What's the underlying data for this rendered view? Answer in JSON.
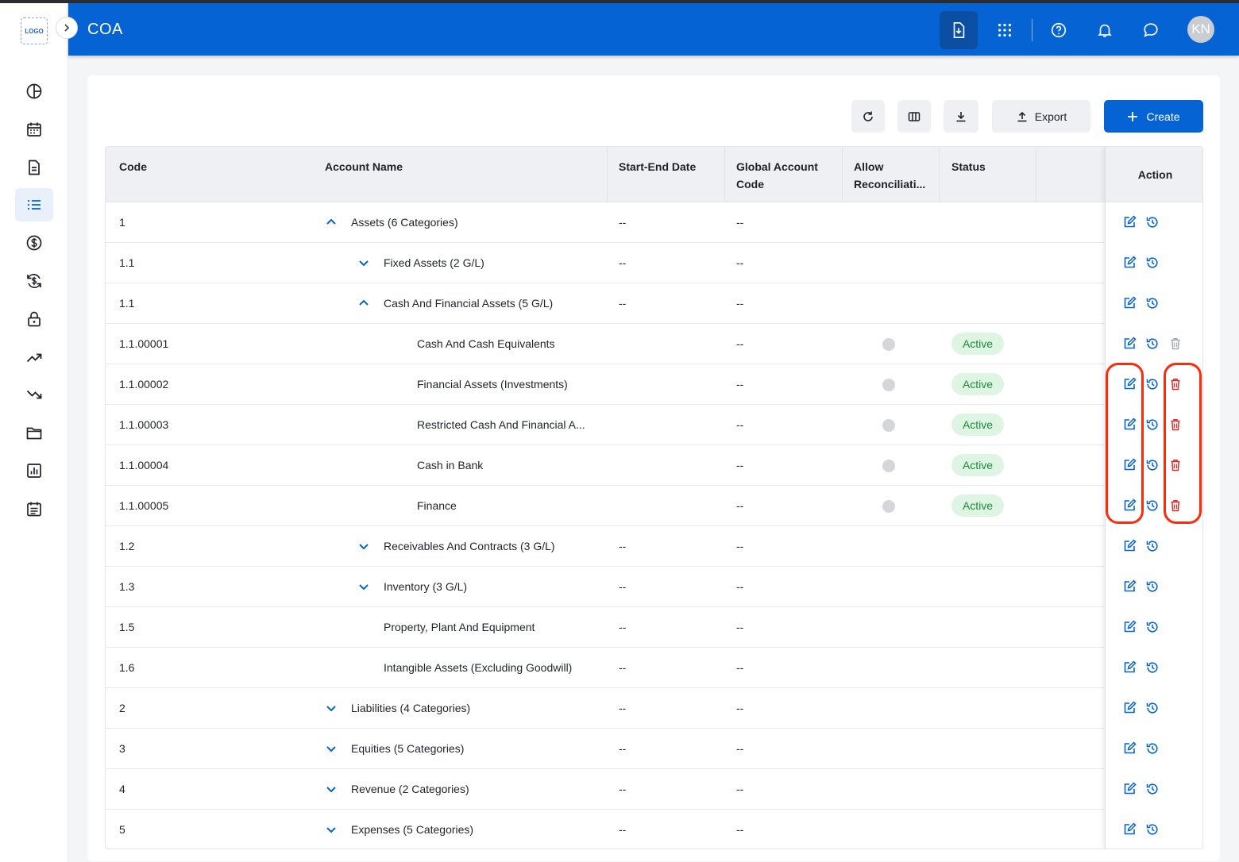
{
  "app": {
    "title": "COA",
    "logo_text": "LOGO",
    "user_initials": "KN"
  },
  "colors": {
    "brand": "#0563d3",
    "active_badge": "#1b8a3b",
    "delete": "#e02b2b",
    "highlight": "#ff2a0a"
  },
  "sidebar": {
    "icons": [
      "dashboard-icon",
      "calendar-icon",
      "document-icon",
      "list-icon",
      "dollar-icon",
      "currency-exchange-icon",
      "lock-icon",
      "trending-up-icon",
      "trending-down-icon",
      "folder-icon",
      "report-icon",
      "notes-icon"
    ],
    "active_index": 3
  },
  "header": {
    "icons": [
      "file-download-icon",
      "apps-grid-icon",
      "help-icon",
      "bell-icon",
      "chat-icon"
    ]
  },
  "toolbar": {
    "export_label": "Export",
    "create_label": "Create"
  },
  "table": {
    "columns": [
      "Code",
      "Account Name",
      "Start-End Date",
      "Global Account\nCode",
      "Allow\nReconciliati...",
      "Status"
    ],
    "action_header": "Action",
    "rows": [
      {
        "code": "1",
        "name": "Assets (6 Categories)",
        "date": "--",
        "global": "--",
        "level": 0,
        "chevron": "up"
      },
      {
        "code": "1.1",
        "name": "Fixed Assets (2 G/L)",
        "date": "--",
        "global": "--",
        "level": 1,
        "chevron": "down"
      },
      {
        "code": "1.1",
        "name": "Cash And Financial Assets (5 G/L)",
        "date": "--",
        "global": "--",
        "level": 1,
        "chevron": "up"
      },
      {
        "code": "1.1.00001",
        "name": "Cash And Cash Equivalents",
        "date": "",
        "global": "--",
        "level": 2,
        "status": "Active",
        "delete": "grey"
      },
      {
        "code": "1.1.00002",
        "name": "Financial Assets (Investments)",
        "date": "",
        "global": "--",
        "level": 2,
        "status": "Active",
        "delete": "red"
      },
      {
        "code": "1.1.00003",
        "name": "Restricted Cash And Financial A...",
        "date": "",
        "global": "--",
        "level": 2,
        "status": "Active",
        "delete": "red"
      },
      {
        "code": "1.1.00004",
        "name": "Cash in Bank",
        "date": "",
        "global": "--",
        "level": 2,
        "status": "Active",
        "delete": "red"
      },
      {
        "code": "1.1.00005",
        "name": "Finance",
        "date": "",
        "global": "--",
        "level": 2,
        "status": "Active",
        "delete": "red"
      },
      {
        "code": "1.2",
        "name": "Receivables And Contracts (3 G/L)",
        "date": "--",
        "global": "--",
        "level": 1,
        "chevron": "down"
      },
      {
        "code": "1.3",
        "name": "Inventory (3 G/L)",
        "date": "--",
        "global": "--",
        "level": 1,
        "chevron": "down"
      },
      {
        "code": "1.5",
        "name": "Property, Plant And Equipment",
        "date": "--",
        "global": "--",
        "level": 1
      },
      {
        "code": "1.6",
        "name": "Intangible Assets (Excluding Goodwill)",
        "date": "--",
        "global": "--",
        "level": 1
      },
      {
        "code": "2",
        "name": "Liabilities (4 Categories)",
        "date": "--",
        "global": "--",
        "level": 0,
        "chevron": "down"
      },
      {
        "code": "3",
        "name": "Equities (5 Categories)",
        "date": "--",
        "global": "--",
        "level": 0,
        "chevron": "down"
      },
      {
        "code": "4",
        "name": "Revenue (2 Categories)",
        "date": "--",
        "global": "--",
        "level": 0,
        "chevron": "down"
      },
      {
        "code": "5",
        "name": "Expenses (5 Categories)",
        "date": "--",
        "global": "--",
        "level": 0,
        "chevron": "down"
      }
    ]
  }
}
